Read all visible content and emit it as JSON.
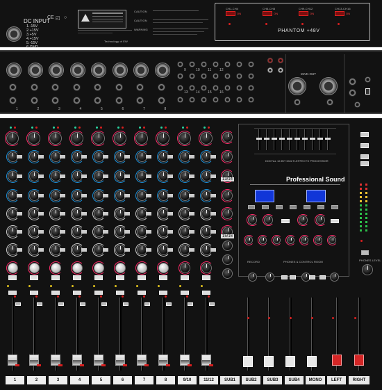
{
  "top_panel": {
    "dc_input_title": "DC INPUT",
    "pins": [
      "1.-15V",
      "2.+15V",
      "3.+5V",
      "4.+15V",
      "5.-15V",
      "6.GND"
    ],
    "tech_text": "Technology of EW",
    "caution_label": "CAUTION",
    "caution2_label": "CAUTION",
    "warning_label": "WARNING",
    "phantom_label": "PHANTOM +48V",
    "phantom_switches": [
      {
        "name": "CH1-CH4",
        "state": "ON"
      },
      {
        "name": "CH5-CH8",
        "state": "ON"
      },
      {
        "name": "CH9-CH12",
        "state": "ON"
      },
      {
        "name": "CH13-CH16",
        "state": "ON"
      }
    ]
  },
  "rear_panel": {
    "main_out_label": "MAIN OUT",
    "channel_numbers": [
      "1",
      "2",
      "3",
      "4",
      "5",
      "6",
      "7",
      "8",
      "9",
      "10",
      "11",
      "12",
      "13",
      "14",
      "15",
      "16"
    ]
  },
  "mixer": {
    "effects_processor_title": "DIGITAL 16 BIT MULTI-EFFECTS PROCESSOR",
    "brand_title": "Professional Sound",
    "sections": {
      "record": "RECORD",
      "phones_control_room": "PHONES & CONTROL ROOM",
      "phones_level": "PHONES LEVEL"
    },
    "channel_labels": [
      "1",
      "2",
      "3",
      "4",
      "5",
      "6",
      "7",
      "8",
      "9/10",
      "11/12",
      "SUB1",
      "SUB2",
      "SUB3",
      "SUB4",
      "MONO",
      "LEFT",
      "RIGHT"
    ],
    "stereo_channel_labels": [
      "13/14",
      "15/16"
    ]
  },
  "colors": {
    "panel": "#121212",
    "led_red": "#d81f1f",
    "lcd_blue": "#1136d8",
    "fader_red": "#d42626",
    "fader_white": "#e8e8e8"
  }
}
